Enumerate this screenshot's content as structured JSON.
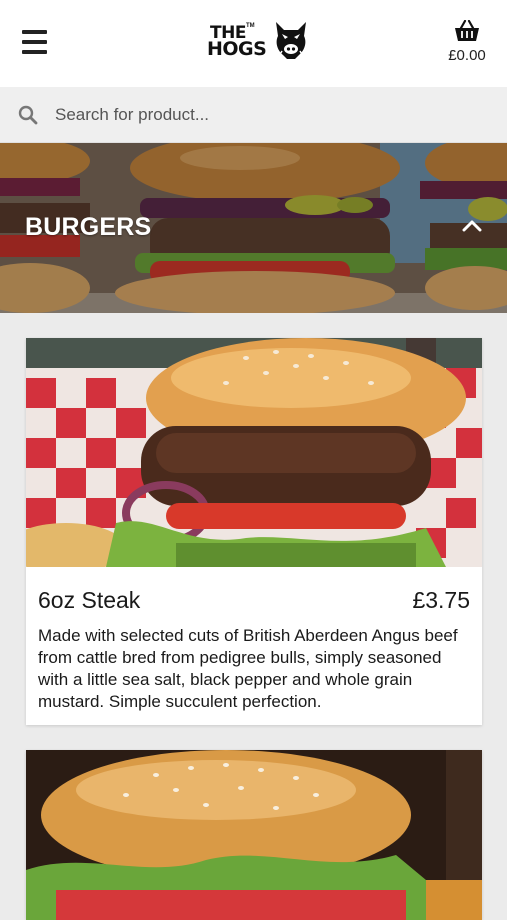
{
  "header": {
    "logo_text_top": "THE",
    "logo_tm": "TM",
    "logo_text_bottom": "HOGS",
    "cart_amount": "£0.00"
  },
  "search": {
    "placeholder": "Search for product..."
  },
  "category": {
    "title": "BURGERS"
  },
  "products": [
    {
      "name": "6oz Steak",
      "price": "£3.75",
      "description": "Made with selected cuts of British Aberdeen Angus beef from cattle bred from pedigree bulls, simply seasoned with a little sea salt, black pepper and whole grain mustard. Simple succulent perfection."
    }
  ],
  "icons": {
    "menu": "hamburger-menu-icon",
    "cart": "basket-icon",
    "search": "search-icon",
    "collapse": "chevron-up-icon"
  }
}
